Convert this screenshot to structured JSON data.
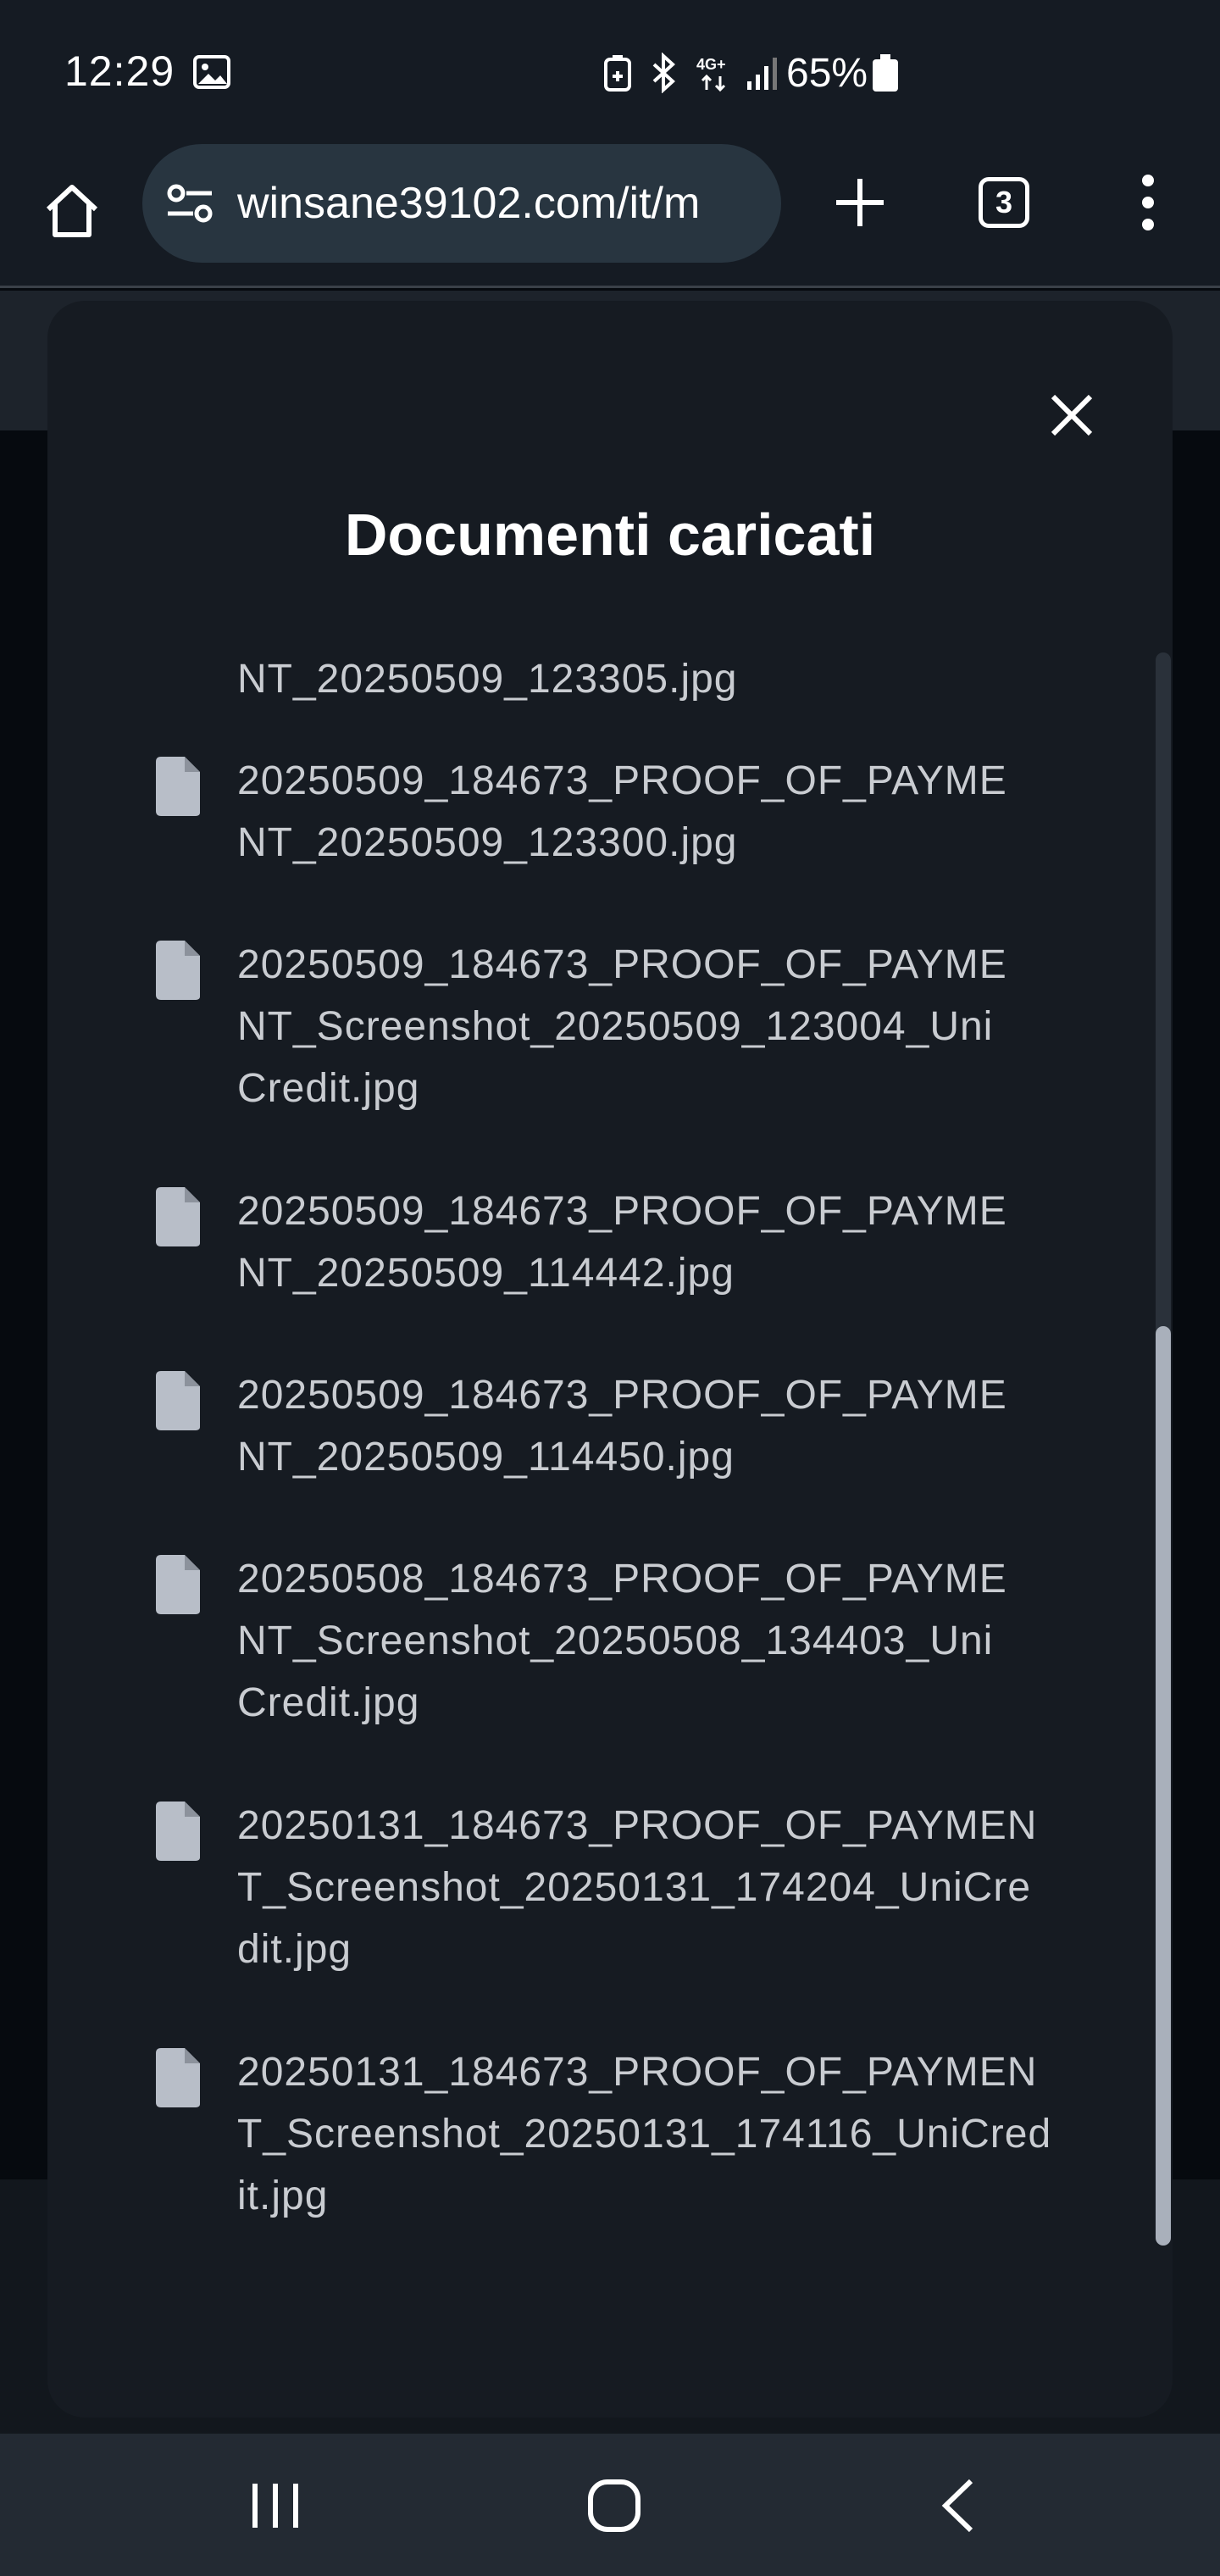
{
  "status_bar": {
    "time": "12:29",
    "battery_percent": "65%",
    "network_label": "4G+"
  },
  "browser": {
    "url": "winsane39102.com/it/m",
    "tab_count": "3"
  },
  "modal": {
    "title": "Documenti caricati",
    "documents": [
      {
        "name": "NT_20250509_123305.jpg",
        "show_icon": false
      },
      {
        "name": "20250509_184673_PROOF_OF_PAYME\nNT_20250509_123300.jpg",
        "show_icon": true
      },
      {
        "name": "20250509_184673_PROOF_OF_PAYME\nNT_Screenshot_20250509_123004_Uni\nCredit.jpg",
        "show_icon": true
      },
      {
        "name": "20250509_184673_PROOF_OF_PAYME\nNT_20250509_114442.jpg",
        "show_icon": true
      },
      {
        "name": "20250509_184673_PROOF_OF_PAYME\nNT_20250509_114450.jpg",
        "show_icon": true
      },
      {
        "name": "20250508_184673_PROOF_OF_PAYME\nNT_Screenshot_20250508_134403_Uni\nCredit.jpg",
        "show_icon": true
      },
      {
        "name": "20250131_184673_PROOF_OF_PAYMEN\nT_Screenshot_20250131_174204_UniCre\ndit.jpg",
        "show_icon": true
      },
      {
        "name": "20250131_184673_PROOF_OF_PAYMEN\nT_Screenshot_20250131_174116_UniCred\nit.jpg",
        "show_icon": true
      }
    ]
  },
  "icons": {
    "home": "home-icon",
    "site_settings": "tune-icon",
    "new_tab": "plus-icon",
    "tabs": "tab-switcher-icon",
    "menu": "more-vert-icon",
    "close": "close-icon",
    "document": "file-icon",
    "nav_recent": "recent-apps-icon",
    "nav_home": "nav-home-icon",
    "nav_back": "back-icon"
  },
  "colors": {
    "modal_bg": "#161b22",
    "text_primary": "#ffffff",
    "text_secondary": "#c9ccd1",
    "icon_doc": "#b8bec8"
  }
}
